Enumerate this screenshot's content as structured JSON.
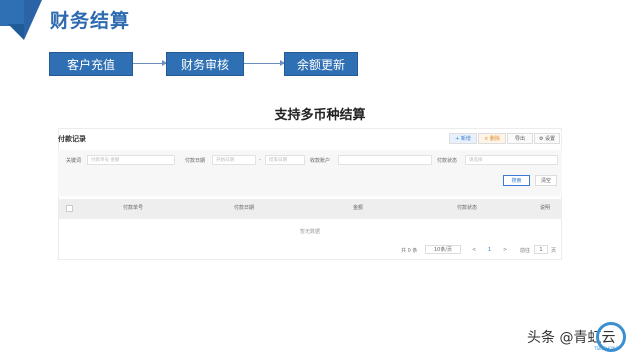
{
  "header": {
    "title": "财务结算"
  },
  "flow": {
    "steps": [
      "客户充值",
      "财务审核",
      "余额更新"
    ]
  },
  "subtitle": "支持多币种结算",
  "panel": {
    "title": "付款记录",
    "toolbar": [
      "+ 新增",
      "× 删除",
      "导出",
      "⚙ 设置"
    ],
    "filters": {
      "keyword_label": "关键词",
      "keyword_placeholder": "付款单号 金额",
      "date_label": "付款日期",
      "date_start_placeholder": "开始日期",
      "date_sep": "-",
      "date_end_placeholder": "结束日期",
      "account_label": "收款账户",
      "status_label": "付款状态",
      "status_placeholder": "请选择"
    },
    "search_label": "搜索",
    "reset_label": "清空",
    "columns": [
      "付款单号",
      "付款日期",
      "金额",
      "付款状态",
      "说明"
    ],
    "empty_text": "暂无数据",
    "pagination": {
      "total": "共 0 条",
      "page_size": "10条/页",
      "prev": "<",
      "page": "1",
      "next": ">",
      "goto_label": "前往",
      "goto_value": "1",
      "goto_suffix": "页"
    }
  },
  "watermark": {
    "text": "头条 @青虹云",
    "logo_sub": "TSINGHONG"
  },
  "colors": {
    "brand_blue": "#2f6fb4"
  }
}
